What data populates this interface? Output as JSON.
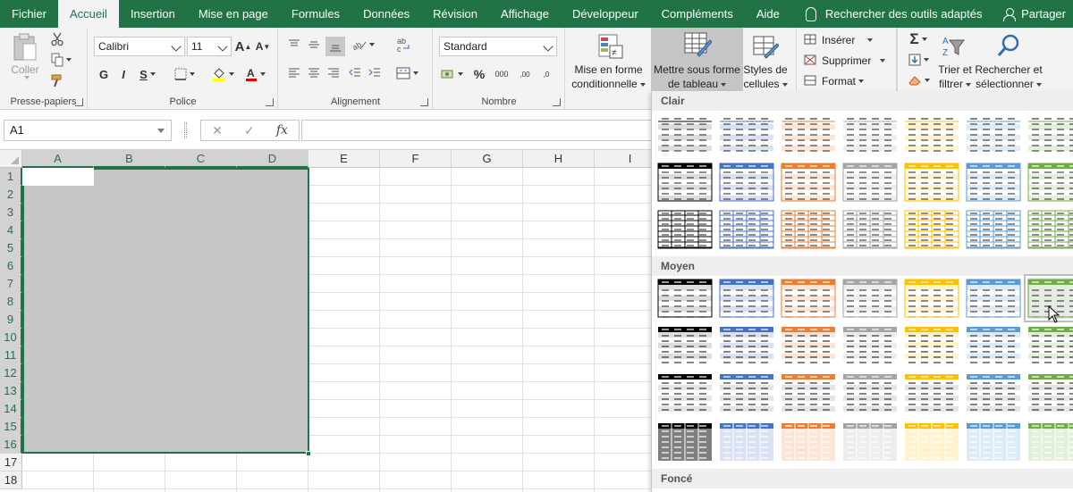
{
  "tabs": [
    {
      "label": "Fichier",
      "active": false
    },
    {
      "label": "Accueil",
      "active": true
    },
    {
      "label": "Insertion",
      "active": false
    },
    {
      "label": "Mise en page",
      "active": false
    },
    {
      "label": "Formules",
      "active": false
    },
    {
      "label": "Données",
      "active": false
    },
    {
      "label": "Révision",
      "active": false
    },
    {
      "label": "Affichage",
      "active": false
    },
    {
      "label": "Développeur",
      "active": false
    },
    {
      "label": "Compléments",
      "active": false
    },
    {
      "label": "Aide",
      "active": false
    }
  ],
  "tellme": "Rechercher des outils adaptés",
  "share": "Partager",
  "ribbon": {
    "clipboard": {
      "label": "Presse-papiers",
      "paste": "Coller"
    },
    "font": {
      "label": "Police",
      "name": "Calibri",
      "size": "11",
      "bold": "G",
      "italic": "I",
      "underline": "S",
      "grow": "A",
      "shrink": "A"
    },
    "alignment": {
      "label": "Alignement"
    },
    "number": {
      "label": "Nombre",
      "format": "Standard",
      "percent": "%",
      "thousands": "000",
      "inc_decimal": ",00",
      "dec_decimal": ",0"
    },
    "styles": {
      "conditional": [
        "Mise en forme",
        "conditionnelle"
      ],
      "format_table": [
        "Mettre sous forme",
        "de tableau"
      ],
      "cell_styles": [
        "Styles de",
        "cellules"
      ]
    },
    "cells": {
      "insert": "Insérer",
      "delete": "Supprimer",
      "format": "Format"
    },
    "editing": {
      "sort": [
        "Trier et",
        "filtrer"
      ],
      "find": [
        "Rechercher et",
        "sélectionner"
      ]
    }
  },
  "formula_bar": {
    "namebox": "A1",
    "cancel": "✕",
    "enter": "✓",
    "fx": "fx",
    "value": ""
  },
  "grid": {
    "columns": [
      "A",
      "B",
      "C",
      "D",
      "E",
      "F",
      "G",
      "H",
      "I"
    ],
    "rows": [
      "1",
      "2",
      "3",
      "4",
      "5",
      "6",
      "7",
      "8",
      "9",
      "10",
      "11",
      "12",
      "13",
      "14",
      "15",
      "16",
      "17",
      "18"
    ],
    "selected_columns": [
      "A",
      "B",
      "C",
      "D"
    ],
    "selected_rows": 16
  },
  "gallery": {
    "sections": [
      "Clair",
      "Moyen",
      "Foncé"
    ],
    "palette": [
      "#000000",
      "#4472c4",
      "#ed7d31",
      "#a5a5a5",
      "#ffc000",
      "#5b9bd5",
      "#70ad47"
    ],
    "light": [
      "#dddddd",
      "#d9e1f2",
      "#fce4d6",
      "#ededed",
      "#fff2cc",
      "#ddebf7",
      "#e2efda"
    ]
  }
}
